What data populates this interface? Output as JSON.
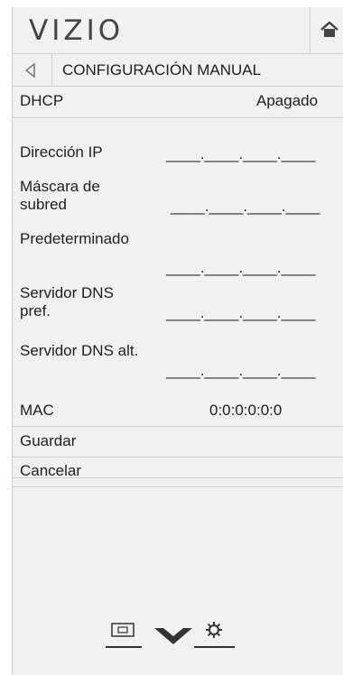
{
  "header": {
    "logo": "VIZIO",
    "home_icon": "home-icon"
  },
  "titlebar": {
    "back_icon": "back-arrow-icon",
    "title": "CONFIGURACIÓN MANUAL"
  },
  "dhcp": {
    "label": "DHCP",
    "value": "Apagado"
  },
  "fields": [
    {
      "label": "Dirección IP",
      "value": "____.____.____.____"
    },
    {
      "label": "Máscara de subred",
      "value": "____.____.____.____"
    },
    {
      "label": "Predeterminado",
      "value": "____.____.____.____"
    },
    {
      "label": "Servidor DNS pref.",
      "value": "____.____.____.____"
    },
    {
      "label": "Servidor DNS alt.",
      "value": "____.____.____.____"
    }
  ],
  "mac": {
    "label": "MAC",
    "value": "0:0:0:0:0:0"
  },
  "actions": {
    "save": "Guardar",
    "cancel": "Cancelar"
  },
  "bottom_nav": {
    "icons": [
      "input-icon",
      "chevron-down-icon",
      "gear-icon"
    ]
  }
}
